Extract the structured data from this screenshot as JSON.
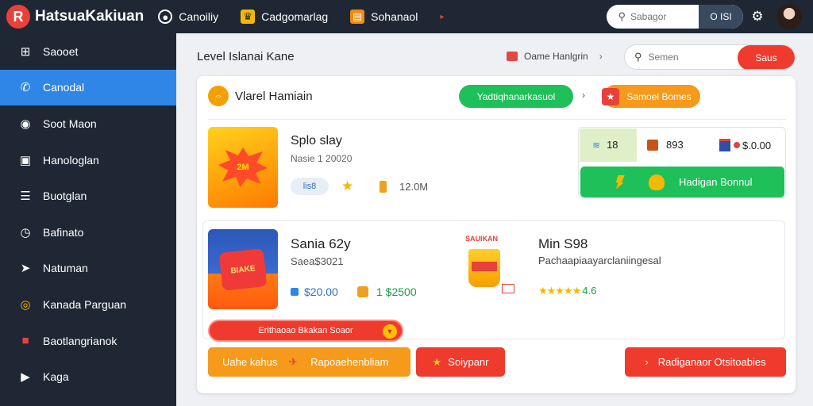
{
  "app": {
    "logo_letter": "R",
    "name": "HatsuaKakiuan"
  },
  "topnav": [
    {
      "label": "Canoiliy",
      "icon": "loading-ring-icon"
    },
    {
      "label": "Cadgomarlag",
      "icon": "trophy-icon"
    },
    {
      "label": "Sohanaol",
      "icon": "folder-icon"
    }
  ],
  "topnav_more_icon": "caret-icon",
  "top_search": {
    "placeholder": "Sabagor",
    "button": "O ISI"
  },
  "sidebar": {
    "items": [
      {
        "label": "Saooet",
        "icon": "grid-icon"
      },
      {
        "label": "Canodal",
        "icon": "phone-icon",
        "active": true
      },
      {
        "label": "Soot Maon",
        "icon": "gamepad-icon"
      },
      {
        "label": "Hanologlan",
        "icon": "image-icon"
      },
      {
        "label": "Buotglan",
        "icon": "list-icon"
      },
      {
        "label": "Bafinato",
        "icon": "clock-icon"
      },
      {
        "label": "Natuman",
        "icon": "pin-icon"
      },
      {
        "label": "Kanada Parguan",
        "icon": "target-icon"
      },
      {
        "label": "Baotlangrianok",
        "icon": "gift-icon"
      },
      {
        "label": "Kaga",
        "icon": "play-icon"
      }
    ]
  },
  "main": {
    "title": "Level Islanai Kane",
    "breadcrumb": {
      "label": "Oame Hanlgrin",
      "separator": "›"
    },
    "search": {
      "placeholder": "Semen",
      "button": "Saus"
    }
  },
  "card": {
    "header": {
      "icon_text": "⇔",
      "title": "Vlarel Hamiain",
      "green_pill": "Yadtiqhanarkasuol",
      "separator": "›",
      "orange_pill": "Samoel Bomes"
    },
    "game1": {
      "art_text": "2M",
      "title": "Splo slay",
      "subtitle": "Nasie 1 20020",
      "tag": "lis8",
      "size": "12.0M"
    },
    "stats": {
      "s1": "18",
      "s2": "893",
      "s3": "$.0.00",
      "bonus_button": "Hadigan Bonnul"
    },
    "game2": {
      "art_text": "BIAKE",
      "title": "Sania 62y",
      "subtitle": "Saea$3021",
      "price1": "$20.00",
      "price2": "1 $2500"
    },
    "game3": {
      "art_label": "SAUIKAN",
      "title": "Min S98",
      "subtitle": "Pachaapiaayarclaniingesal",
      "stars": "★★★★★",
      "rating": "4.6"
    },
    "red_pill": "Erithaoao Bkakan Soaor",
    "buttons": {
      "b1_left": "Uahe kahus",
      "b1_right": "Rapoaehenbliam",
      "b2": "Soiypanr",
      "b3": "Radiganaor Otsitoabies"
    }
  }
}
